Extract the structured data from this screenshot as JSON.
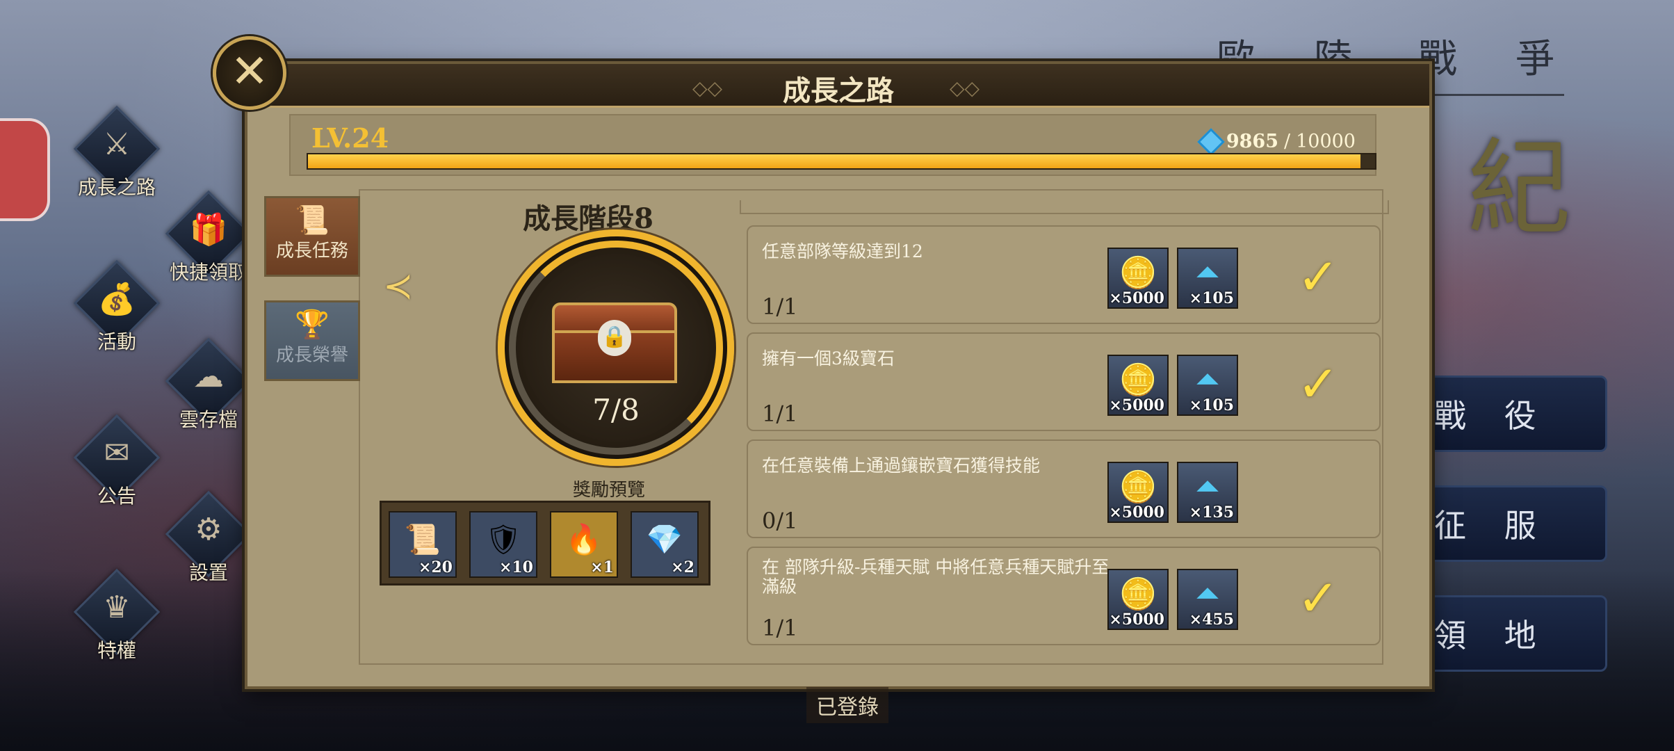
{
  "background": {
    "game_title_chars": [
      "歐",
      "陸",
      "戰",
      "爭"
    ],
    "big_glyph": "紀",
    "menu": [
      "戰 役",
      "征 服",
      "領 地"
    ],
    "logged_text": "已登錄"
  },
  "side_icons": [
    {
      "label": "成長之路",
      "icon": "sword-icon",
      "glyph": "⚔"
    },
    {
      "label": "快捷領取",
      "icon": "gift-icon",
      "glyph": "🎁"
    },
    {
      "label": "活動",
      "icon": "money-bag-icon",
      "glyph": "💰"
    },
    {
      "label": "雲存檔",
      "icon": "cloud-upload-icon",
      "glyph": "☁"
    },
    {
      "label": "公告",
      "icon": "envelope-icon",
      "glyph": "✉"
    },
    {
      "label": "設置",
      "icon": "gear-icon",
      "glyph": "⚙"
    },
    {
      "label": "特權",
      "icon": "crown-icon",
      "glyph": "♛"
    }
  ],
  "panel": {
    "title": "成長之路",
    "close_glyph": "✕",
    "level": "LV.24",
    "xp_current": "9865",
    "xp_sep": "/",
    "xp_max": "10000",
    "xp_progress": 0.9865,
    "tabs": [
      {
        "label": "成長任務",
        "icon": "scroll-quill-icon",
        "glyph": "📜",
        "active": true
      },
      {
        "label": "成長榮譽",
        "icon": "chest-icon",
        "glyph": "🏆",
        "active": false
      }
    ],
    "stage": {
      "title": "成長階段8",
      "count": "7/8",
      "arrow": "≺"
    },
    "preview": {
      "label": "獎勵預覽",
      "items": [
        {
          "icon": "scroll-map-icon",
          "glyph": "📜",
          "qty": "×20",
          "bg": "#3d4b63"
        },
        {
          "icon": "shield-icon",
          "glyph": "🛡",
          "qty": "×10",
          "bg": "#3d4b63"
        },
        {
          "icon": "campfire-icon",
          "glyph": "🔥",
          "qty": "×1",
          "bg": "#b0892e"
        },
        {
          "icon": "emerald-icon",
          "glyph": "💎",
          "qty": "×2",
          "bg": "#3d4b63"
        }
      ]
    },
    "tasks": [
      {
        "desc": "任意部隊等級達到12",
        "progress": "1/1",
        "gold": "×5000",
        "xp": "×105",
        "done": true
      },
      {
        "desc": "擁有一個3級寶石",
        "progress": "1/1",
        "gold": "×5000",
        "xp": "×105",
        "done": true
      },
      {
        "desc": "在任意裝備上通過鑲嵌寶石獲得技能",
        "progress": "0/1",
        "gold": "×5000",
        "xp": "×135",
        "done": false
      },
      {
        "desc": "在 部隊升級-兵種天賦 中將任意兵種天賦升至滿級",
        "progress": "1/1",
        "gold": "×5000",
        "xp": "×455",
        "done": true
      }
    ]
  }
}
